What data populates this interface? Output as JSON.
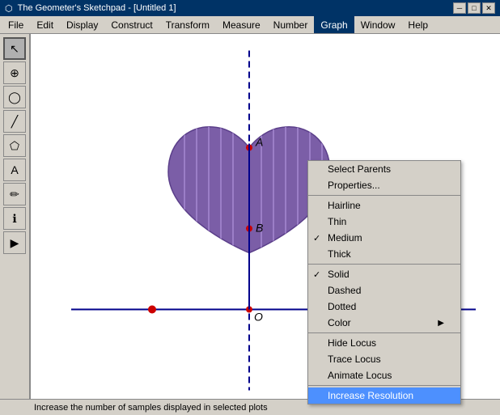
{
  "titleBar": {
    "icon": "⬡",
    "title": "The Geometer's Sketchpad - [Untitled 1]",
    "minimize": "─",
    "maximize": "□",
    "close": "✕"
  },
  "menuBar": {
    "items": [
      "File",
      "Edit",
      "Display",
      "Construct",
      "Transform",
      "Measure",
      "Number",
      "Graph",
      "Window",
      "Help"
    ]
  },
  "toolbar": {
    "tools": [
      {
        "name": "select",
        "icon": "↖",
        "label": "select-tool"
      },
      {
        "name": "point",
        "icon": "⊕",
        "label": "point-tool"
      },
      {
        "name": "compass",
        "icon": "◯",
        "label": "compass-tool"
      },
      {
        "name": "line",
        "icon": "╱",
        "label": "line-tool"
      },
      {
        "name": "polygon",
        "icon": "⬠",
        "label": "polygon-tool"
      },
      {
        "name": "text",
        "icon": "A",
        "label": "text-tool"
      },
      {
        "name": "pencil",
        "icon": "✏",
        "label": "pencil-tool"
      },
      {
        "name": "info",
        "icon": "ℹ",
        "label": "info-tool"
      },
      {
        "name": "play",
        "icon": "▶",
        "label": "play-tool"
      }
    ]
  },
  "contextMenu": {
    "items": [
      {
        "id": "select-parents",
        "label": "Select Parents",
        "type": "normal"
      },
      {
        "id": "properties",
        "label": "Properties...",
        "type": "normal"
      },
      {
        "id": "divider1",
        "type": "divider"
      },
      {
        "id": "hairline",
        "label": "Hairline",
        "type": "normal"
      },
      {
        "id": "thin",
        "label": "Thin",
        "type": "normal"
      },
      {
        "id": "medium",
        "label": "Medium",
        "type": "check",
        "checked": true
      },
      {
        "id": "thick",
        "label": "Thick",
        "type": "normal"
      },
      {
        "id": "divider2",
        "type": "divider"
      },
      {
        "id": "solid",
        "label": "Solid",
        "type": "check",
        "checked": true
      },
      {
        "id": "dashed",
        "label": "Dashed",
        "type": "normal"
      },
      {
        "id": "dotted",
        "label": "Dotted",
        "type": "normal"
      },
      {
        "id": "color",
        "label": "Color",
        "type": "submenu"
      },
      {
        "id": "divider3",
        "type": "divider"
      },
      {
        "id": "hide-locus",
        "label": "Hide Locus",
        "type": "normal"
      },
      {
        "id": "trace-locus",
        "label": "Trace Locus",
        "type": "normal"
      },
      {
        "id": "animate-locus",
        "label": "Animate Locus",
        "type": "normal"
      },
      {
        "id": "divider4",
        "type": "divider"
      },
      {
        "id": "increase-resolution",
        "label": "Increase Resolution",
        "type": "highlighted"
      }
    ]
  },
  "statusBar": {
    "text": "Increase the number of samples displayed in selected plots"
  },
  "canvas": {
    "heartColor": "#7B5EA7",
    "heartStroke": "#5b3f8a",
    "stripeColor": "#8B5FBF",
    "axisColor": "#00008B",
    "pointColor": "#cc0000",
    "labelA": "A",
    "labelB": "B",
    "labelO": "O"
  }
}
